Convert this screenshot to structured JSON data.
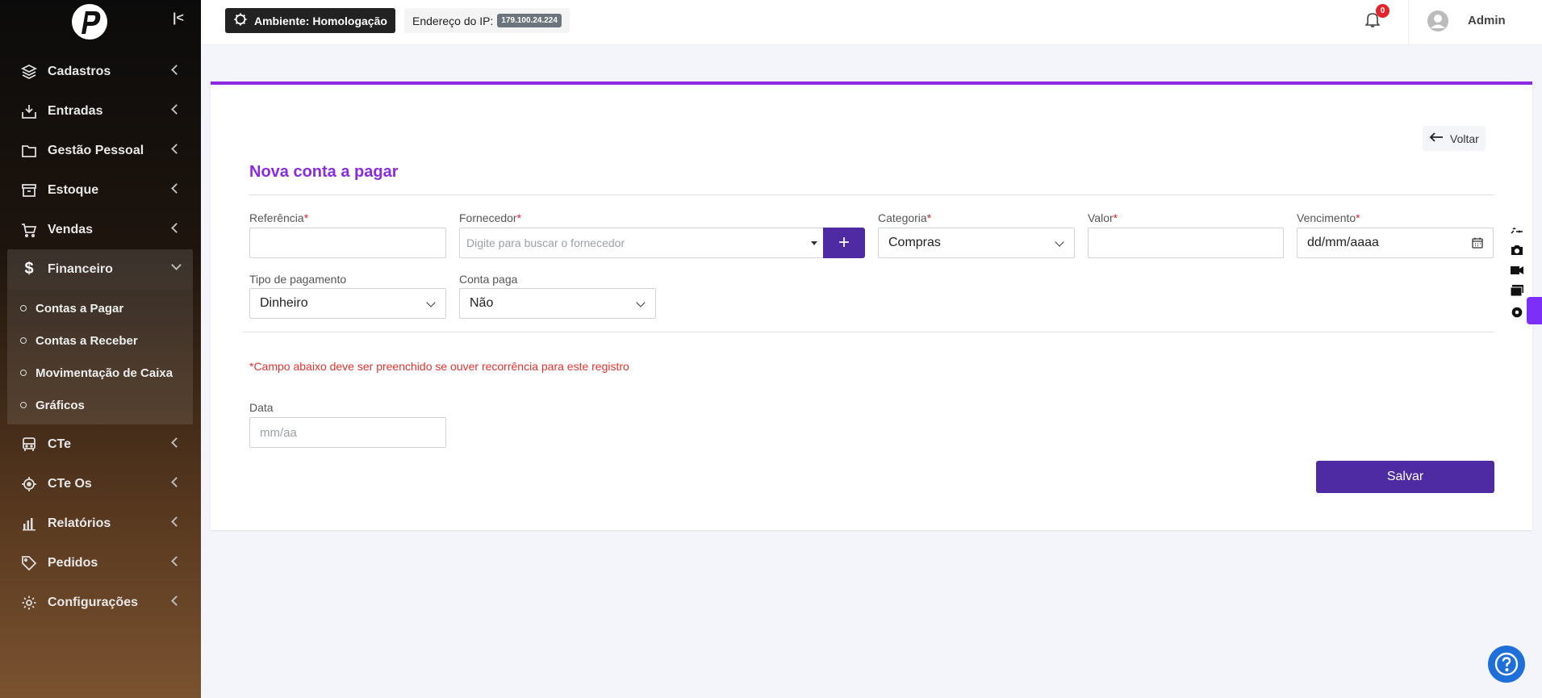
{
  "sidebar": {
    "items": [
      {
        "label": "Cadastros",
        "icon": "layers-icon"
      },
      {
        "label": "Entradas",
        "icon": "inbox-download-icon"
      },
      {
        "label": "Gestão Pessoal",
        "icon": "folder-icon"
      },
      {
        "label": "Estoque",
        "icon": "archive-icon"
      },
      {
        "label": "Vendas",
        "icon": "cart-icon"
      },
      {
        "label": "Financeiro",
        "icon": "dollar-icon"
      },
      {
        "label": "CTe",
        "icon": "bus-icon"
      },
      {
        "label": "CTe Os",
        "icon": "target-icon"
      },
      {
        "label": "Relatórios",
        "icon": "bar-chart-icon"
      },
      {
        "label": "Pedidos",
        "icon": "tag-icon"
      },
      {
        "label": "Configurações",
        "icon": "gear-icon"
      }
    ],
    "submenu": [
      {
        "label": "Contas a Pagar"
      },
      {
        "label": "Contas a Receber"
      },
      {
        "label": "Movimentação de Caixa"
      },
      {
        "label": "Gráficos"
      }
    ]
  },
  "header": {
    "environment": "Ambiente: Homologação",
    "ip_label": "Endereço do IP:",
    "ip_value": "179.100.24.224",
    "notifications": "0",
    "user": "Admin"
  },
  "form": {
    "back_label": "Voltar",
    "title": "Nova conta a pagar",
    "referencia_label": "Referência",
    "fornecedor_label": "Fornecedor",
    "fornecedor_placeholder": "Digite para buscar o fornecedor",
    "categoria_label": "Categoria",
    "categoria_value": "Compras",
    "valor_label": "Valor",
    "vencimento_label": "Vencimento",
    "vencimento_value": "dd/mm/aaaa",
    "tipo_pagamento_label": "Tipo de pagamento",
    "tipo_pagamento_value": "Dinheiro",
    "conta_paga_label": "Conta paga",
    "conta_paga_value": "Não",
    "recurrence_note": "*Campo abaixo deve ser preenchido se ouver recorrência para este registro",
    "data_label": "Data",
    "data_placeholder": "mm/aa",
    "required_mark": "*",
    "plus_label": "+",
    "save_label": "Salvar"
  },
  "colors": {
    "accent": "#8a2be2",
    "primary_button": "#4e2aa3",
    "required": "#e3242b",
    "help": "#1e6fd9"
  }
}
